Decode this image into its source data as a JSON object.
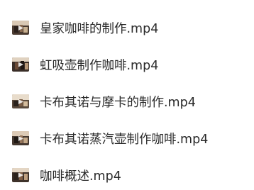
{
  "files": [
    {
      "name": "皇家咖啡的制作.mp4",
      "icon": "video-thumbnail-icon"
    },
    {
      "name": "虹吸壶制作咖啡.mp4",
      "icon": "video-thumbnail-icon"
    },
    {
      "name": "卡布其诺与摩卡的制作.mp4",
      "icon": "video-thumbnail-icon"
    },
    {
      "name": "卡布其诺蒸汽壶制作咖啡.mp4",
      "icon": "video-thumbnail-icon"
    },
    {
      "name": "咖啡概述.mp4",
      "icon": "video-thumbnail-icon"
    }
  ]
}
